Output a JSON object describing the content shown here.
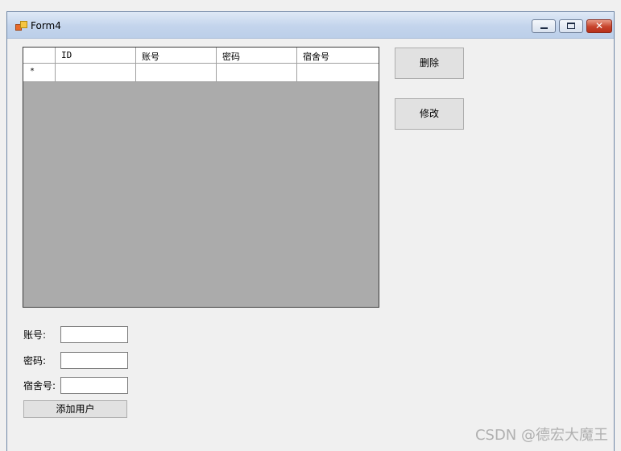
{
  "window": {
    "title": "Form4",
    "close_symbol": "✕"
  },
  "grid": {
    "columns": [
      "",
      "ID",
      "账号",
      "密码",
      "宿舍号"
    ],
    "new_row_marker": "*"
  },
  "buttons": {
    "delete": "删除",
    "edit": "修改",
    "add_user": "添加用户"
  },
  "form": {
    "account_label": "账号:",
    "password_label": "密码:",
    "dorm_label": "宿舍号:",
    "account_value": "",
    "password_value": "",
    "dorm_value": ""
  },
  "watermark": "CSDN @德宏大魔王"
}
